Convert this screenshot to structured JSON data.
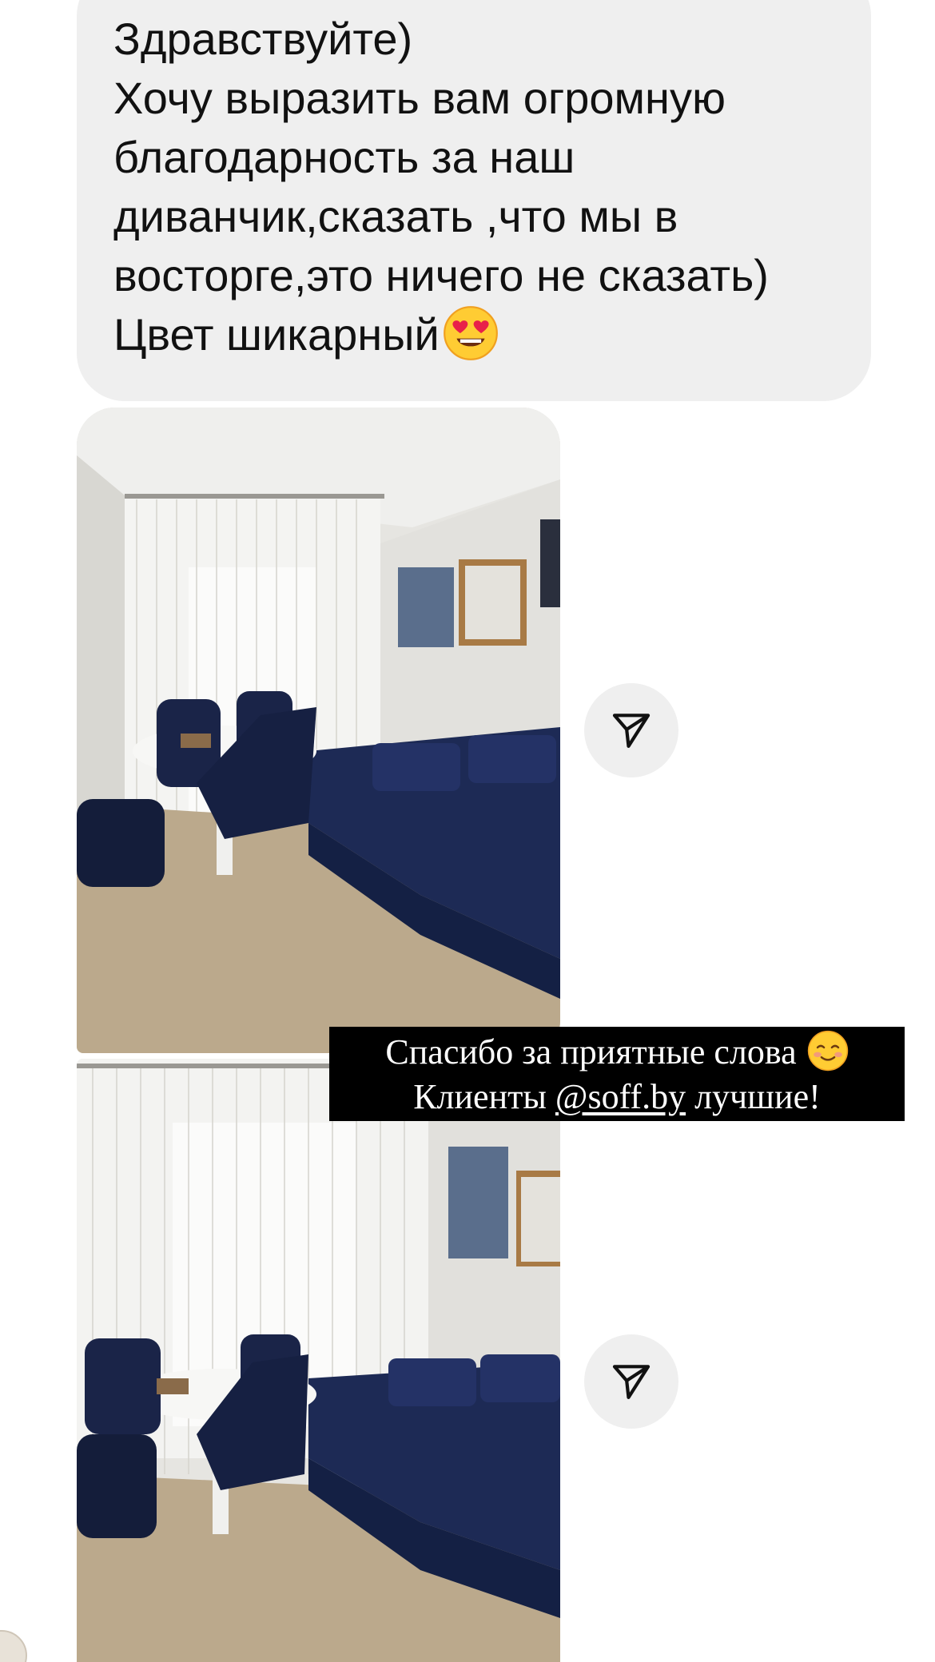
{
  "message": {
    "lines": [
      "Здравствуйте)",
      "Хочу выразить вам огромную",
      "благодарность за наш",
      "диванчик,сказать ,что мы в",
      "восторге,это ничего не сказать)",
      "Цвет шикарный"
    ],
    "trailing_emoji": "smiling-face-with-heart-eyes-icon",
    "bubble_color": "#efefef"
  },
  "photos": [
    {
      "subject": "living room with navy blue sofa, round white table and navy chairs"
    },
    {
      "subject": "living room with navy blue sofa, round white table and navy chairs"
    }
  ],
  "share_buttons": [
    {
      "icon": "paper-plane-icon"
    },
    {
      "icon": "paper-plane-icon"
    }
  ],
  "caption": {
    "line1": "Спасибо за приятные слова",
    "line1_emoji": "smiling-face-icon",
    "line2_prefix": "Клиенты ",
    "mention": "@soff.by",
    "line2_suffix": " лучшие!",
    "background": "#000000",
    "text_color": "#ffffff"
  },
  "colors": {
    "sofa": "#1d2a55",
    "floor": "#b9a78a",
    "wall": "#e9e8e4"
  }
}
